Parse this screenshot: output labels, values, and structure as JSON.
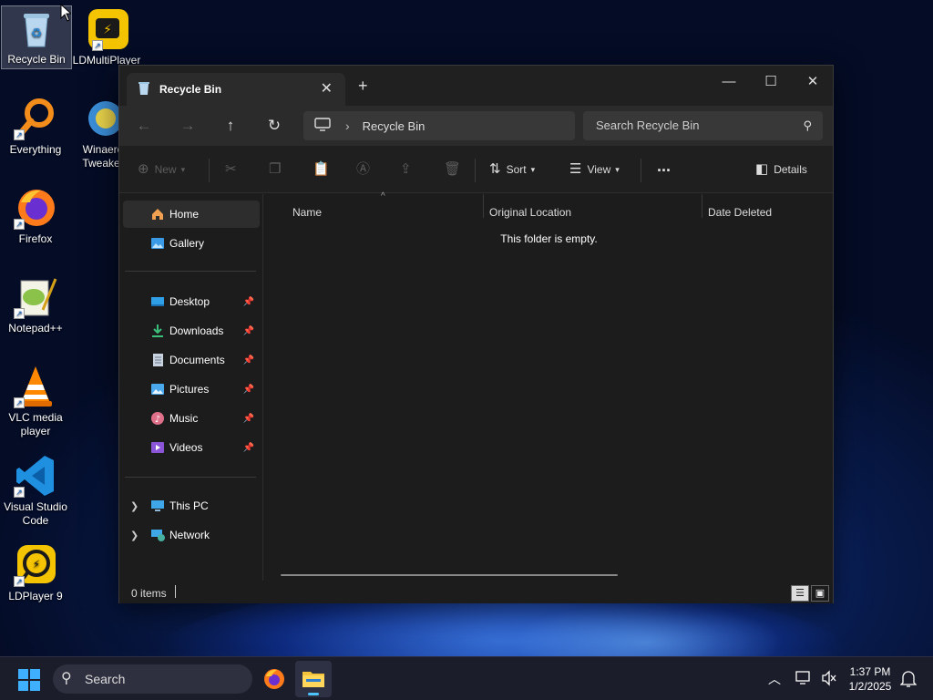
{
  "desktop": {
    "icons": [
      {
        "label": "Recycle Bin",
        "icon": "recycle-bin-icon"
      },
      {
        "label": "LDMultiPlayer",
        "icon": "ldmultiplayer-icon"
      },
      {
        "label": "Everything",
        "icon": "everything-search-icon"
      },
      {
        "label": "Winaero Tweaker",
        "icon": "winaero-tweaker-icon"
      },
      {
        "label": "Firefox",
        "icon": "firefox-icon"
      },
      {
        "label": "Notepad++",
        "icon": "notepad-plus-plus-icon"
      },
      {
        "label": "VLC media player",
        "icon": "vlc-icon"
      },
      {
        "label": "Visual Studio Code",
        "icon": "vscode-icon"
      },
      {
        "label": "LDPlayer 9",
        "icon": "ldplayer-icon"
      }
    ]
  },
  "window": {
    "tab_title": "Recycle Bin",
    "address": {
      "location": "Recycle Bin"
    },
    "search_placeholder": "Search Recycle Bin",
    "toolbar": {
      "new_label": "New",
      "sort_label": "Sort",
      "view_label": "View",
      "more_label": "...",
      "details_label": "Details"
    },
    "sidebar": {
      "home": "Home",
      "gallery": "Gallery",
      "quick_access": [
        "Desktop",
        "Downloads",
        "Documents",
        "Pictures",
        "Music",
        "Videos"
      ],
      "this_pc": "This PC",
      "network": "Network"
    },
    "columns": [
      "Name",
      "Original Location",
      "Date Deleted"
    ],
    "empty_message": "This folder is empty.",
    "status": {
      "item_count": "0 items"
    }
  },
  "taskbar": {
    "search_label": "Search",
    "time": "1:37 PM",
    "date": "1/2/2025",
    "accent": "#4cc2ff"
  }
}
